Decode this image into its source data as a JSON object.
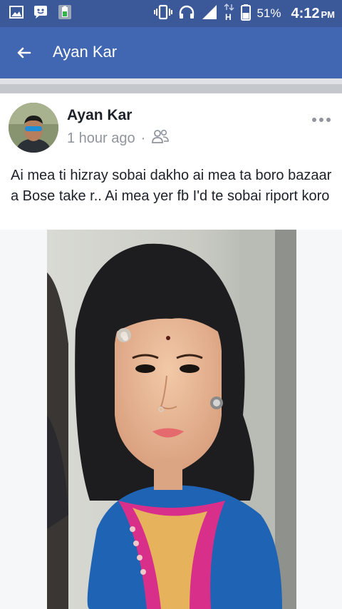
{
  "status_bar": {
    "battery_percent": "51%",
    "time": "4:12",
    "ampm": "PM",
    "icons": [
      "gallery-icon",
      "bbm-icon",
      "battery-app-icon",
      "vibrate-icon",
      "headset-icon",
      "signal-icon",
      "data-h-icon",
      "battery-icon"
    ]
  },
  "app_bar": {
    "title": "Ayan Kar",
    "back_icon": "back-arrow-icon"
  },
  "post": {
    "author": "Ayan Kar",
    "time": "1 hour ago",
    "dot": "·",
    "audience_icon": "friends-icon",
    "more_icon": "more-options-icon",
    "text": "Ai mea ti hizray  sobai dakho  ai mea  ta boro bazaar a Bose take r.. Ai mea yer fb I'd te sobai riport koro"
  },
  "colors": {
    "status_bar": "#3b5998",
    "app_bar": "#4267b2",
    "secondary_text": "#90949c"
  }
}
